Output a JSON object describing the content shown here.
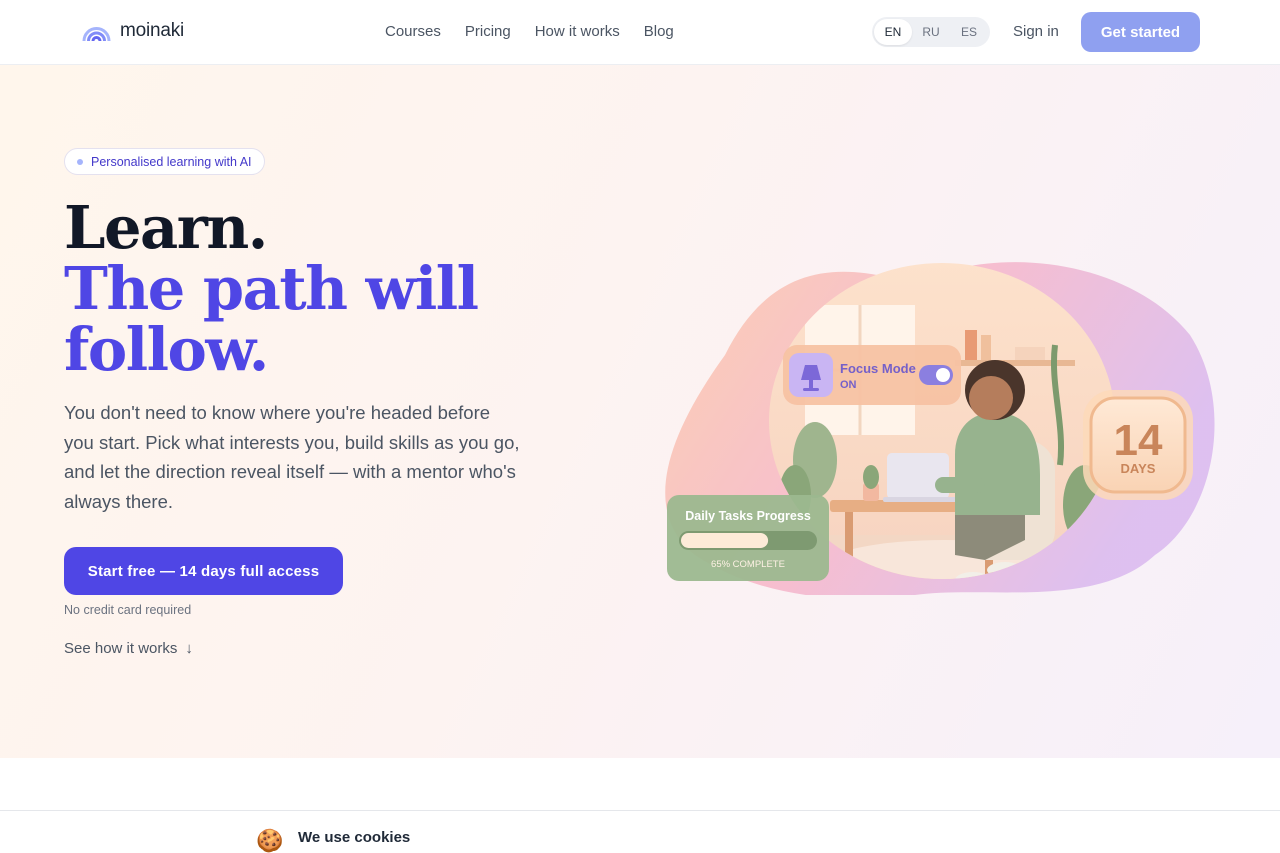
{
  "header": {
    "logo_text": "moinaki",
    "nav": [
      "Courses",
      "Pricing",
      "How it works",
      "Blog"
    ],
    "languages": [
      "EN",
      "RU",
      "ES"
    ],
    "active_language": "EN",
    "sign_in": "Sign in",
    "get_started": "Get started"
  },
  "hero": {
    "badge": "Personalised learning with AI",
    "title_line1": "Learn.",
    "title_line2": "The path will",
    "title_line3": "follow.",
    "subtitle": "You don't need to know where you're headed before you start. Pick what interests you, build skills as you go, and let the direction reveal itself — with a mentor who's always there.",
    "cta": "Start free — 14 days full access",
    "note": "No credit card required",
    "see_how": "See how it works",
    "see_how_arrow": "↓"
  },
  "illustration": {
    "focus_title": "Focus Mode",
    "focus_state": "ON",
    "days_number": "14",
    "days_label": "DAYS",
    "progress_title": "Daily Tasks Progress",
    "progress_label": "65% COMPLETE",
    "progress_fraction": 0.65
  },
  "cookie": {
    "icon": "cookie-icon",
    "title": "We use cookies"
  },
  "colors": {
    "accent": "#4f46e5",
    "get_started_bg": "#8fa0f0",
    "title_dark": "#111827"
  }
}
